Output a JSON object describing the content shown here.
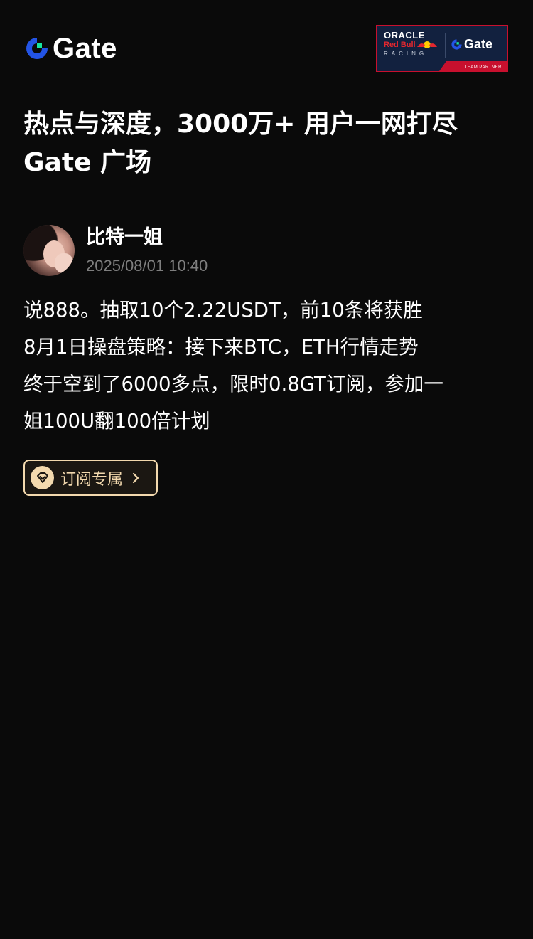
{
  "header": {
    "logo_text": "Gate",
    "partner_badge": {
      "line1": "ORACLE",
      "line2": "Red Bull",
      "line3": "RACING",
      "brand": "Gate",
      "footer": "TEAM PARTNER"
    }
  },
  "headline": {
    "line1": "热点与深度，3000万+ 用户一网打尽",
    "line2": "Gate 广场"
  },
  "post": {
    "author": "比特一姐",
    "time": "2025/08/01 10:40",
    "body_lines": [
      "说888。抽取10个2.22USDT，前10条将获胜",
      "8月1日操盘策略：接下来BTC，ETH行情走势",
      "终于空到了6000多点，限时0.8GT订阅，参加一",
      "姐100U翻100倍计划"
    ],
    "subscribe_label": "订阅专属"
  },
  "colors": {
    "background": "#0a0a0a",
    "brand_blue": "#2354e6",
    "brand_green": "#17e6a1",
    "gold": "#f3d9ae",
    "muted": "#7f7f7f"
  },
  "icons": {
    "logo": "gate-logo-icon",
    "subscribe": "diamond-icon",
    "chevron": "chevron-right-icon"
  }
}
